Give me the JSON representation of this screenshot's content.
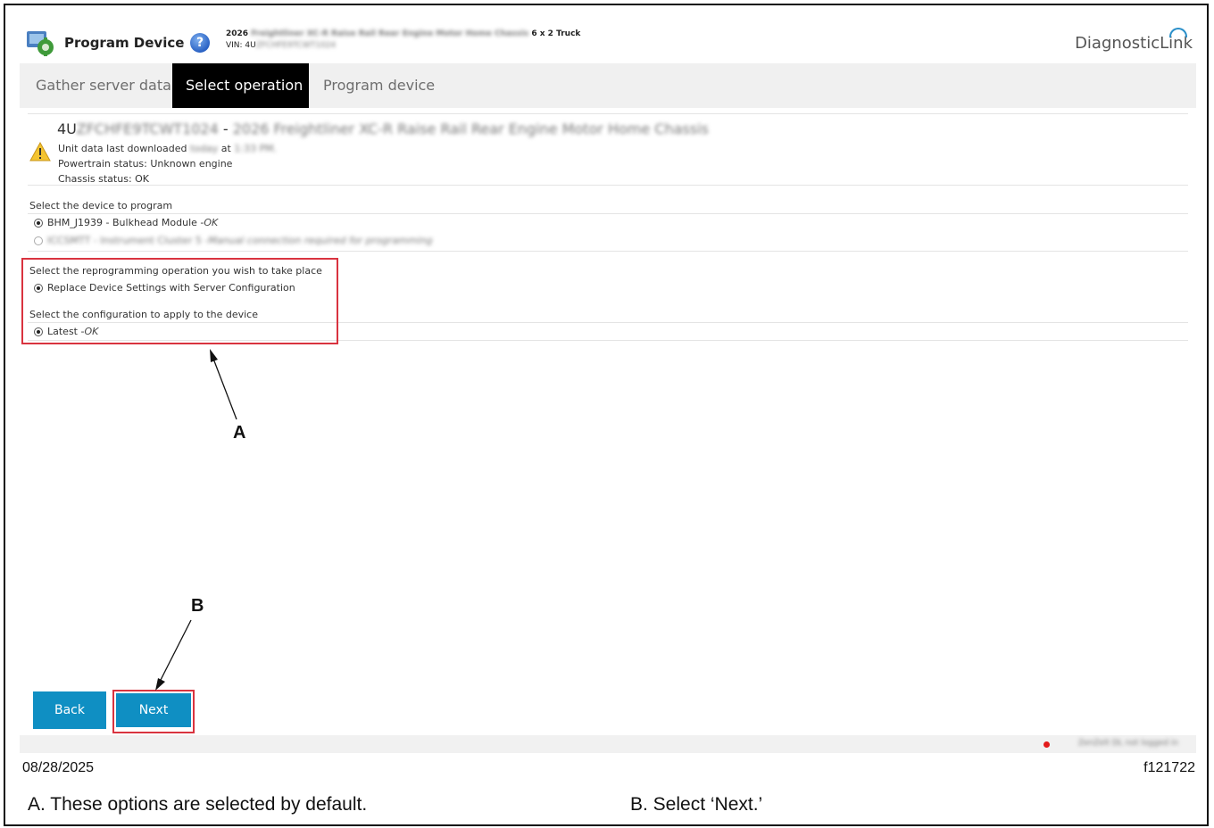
{
  "app": {
    "title": "Program Device",
    "help_icon": "help-icon",
    "brand": "DiagnosticLink"
  },
  "vehicle": {
    "line1_year": "2026",
    "line1_model": "Freightliner XC-R Raise Rail Rear Engine Motor Home Chassis",
    "line1_config": "6 x 2 Truck",
    "line2_prefix": "VIN: 4U",
    "line2_vin_rest": "ZFCHFE9TCWT1024"
  },
  "tabs": [
    {
      "label": "Gather server data",
      "active": false
    },
    {
      "label": "Select operation",
      "active": true
    },
    {
      "label": "Program device",
      "active": false
    }
  ],
  "unit": {
    "vin_prefix": "4U",
    "vin_rest": "ZFCHFE9TCWT1024",
    "separator": " - ",
    "description": "2026 Freightliner XC-R Raise Rail Rear Engine Motor Home Chassis",
    "download_label": "Unit data last downloaded",
    "download_day": "today",
    "download_at": "at",
    "download_time": "1:33 PM.",
    "powertrain_status": "Powertrain status: Unknown engine",
    "chassis_status": "Chassis status: OK",
    "warning_icon": "warning-icon"
  },
  "device_section": {
    "label": "Select the device to program",
    "options": [
      {
        "name": "BHM_J1939 - Bulkhead Module - ",
        "status": "OK",
        "selected": true,
        "enabled": true
      },
      {
        "name": "ICCSMTT - Instrument Cluster 5 - ",
        "status": "Manual connection required for programming",
        "selected": false,
        "enabled": false
      }
    ]
  },
  "operation_section": {
    "label": "Select the reprogramming operation you wish to take place",
    "option": "Replace Device Settings with Server Configuration"
  },
  "config_section": {
    "label": "Select the configuration to apply to the device",
    "option_name": "Latest - ",
    "option_status": "OK"
  },
  "buttons": {
    "back": "Back",
    "next": "Next"
  },
  "footer": {
    "login_status": "ZenZelt DL not logged in"
  },
  "callouts": {
    "a": "A",
    "b": "B"
  },
  "page": {
    "date": "08/28/2025",
    "figure_id": "f121722",
    "caption_a": "A. These options are selected by default.",
    "caption_b": "B. Select ‘Next.’"
  },
  "colors": {
    "tab_active_bg": "#000000",
    "button_bg": "#0f8fc3",
    "highlight": "#d9333f",
    "status_dot": "#e31b1b"
  }
}
